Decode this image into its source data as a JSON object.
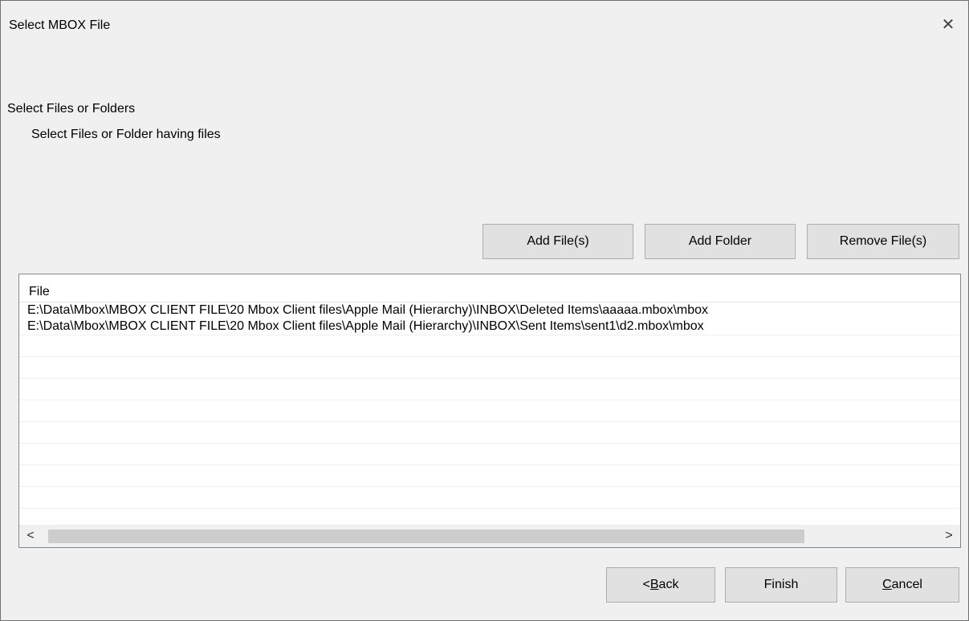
{
  "window": {
    "title": "Select MBOX File",
    "close_glyph": "✕"
  },
  "content": {
    "heading": "Select Files or Folders",
    "subheading": "Select Files or Folder having files"
  },
  "toolbar": {
    "add_files_label": "Add File(s)",
    "add_folder_label": "Add Folder",
    "remove_files_label": "Remove File(s)"
  },
  "file_list": {
    "columns": [
      "File"
    ],
    "rows": [
      "E:\\Data\\Mbox\\MBOX CLIENT FILE\\20 Mbox Client files\\Apple Mail (Hierarchy)\\INBOX\\Deleted Items\\aaaaa.mbox\\mbox",
      "E:\\Data\\Mbox\\MBOX CLIENT FILE\\20 Mbox Client files\\Apple Mail (Hierarchy)\\INBOX\\Sent Items\\sent1\\d2.mbox\\mbox"
    ],
    "scroll_left_glyph": "<",
    "scroll_right_glyph": ">"
  },
  "footer": {
    "back_prefix": "<",
    "back_mnemonic": "B",
    "back_rest": "ack",
    "finish_label": "Finish",
    "cancel_mnemonic": "C",
    "cancel_rest": "ancel"
  },
  "icons": {
    "close": "close-icon",
    "scroll_left": "chevron-left-icon",
    "scroll_right": "chevron-right-icon"
  }
}
